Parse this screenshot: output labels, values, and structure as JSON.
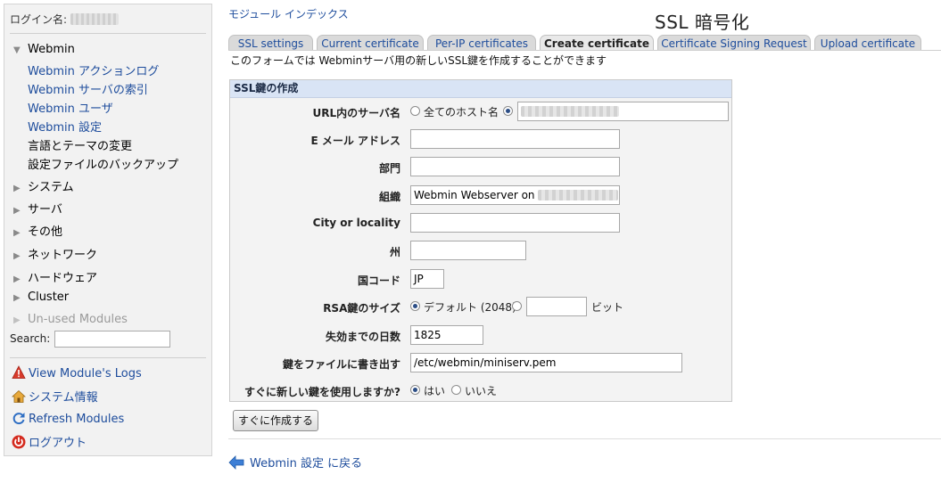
{
  "sidebar": {
    "login_label": "ログイン名:",
    "webmin_category": "Webmin",
    "webmin_items": [
      "Webmin アクションログ",
      "Webmin サーバの索引",
      "Webmin ユーザ",
      "Webmin 設定",
      "言語とテーマの変更",
      "設定ファイルのバックアップ"
    ],
    "categories": [
      "システム",
      "サーバ",
      "その他",
      "ネットワーク",
      "ハードウェア",
      "Cluster",
      "Un-used Modules"
    ],
    "search_label": "Search:",
    "search_value": "",
    "tools": [
      {
        "label": "View Module's Logs",
        "icon": "warning-icon"
      },
      {
        "label": "システム情報",
        "icon": "home-icon"
      },
      {
        "label": "Refresh Modules",
        "icon": "refresh-icon"
      },
      {
        "label": "ログアウト",
        "icon": "power-icon"
      }
    ]
  },
  "header": {
    "module_index": "モジュール インデックス",
    "title": "SSL 暗号化"
  },
  "tabs": [
    {
      "label": "SSL settings",
      "active": false
    },
    {
      "label": "Current certificate",
      "active": false
    },
    {
      "label": "Per-IP certificates",
      "active": false
    },
    {
      "label": "Create certificate",
      "active": true
    },
    {
      "label": "Certificate Signing Request",
      "active": false
    },
    {
      "label": "Upload certificate",
      "active": false
    }
  ],
  "description": "このフォームでは Webminサーバ用の新しいSSL鍵を作成することができます",
  "form": {
    "header": "SSL鍵の作成",
    "hostname_label": "URL内のサーバ名",
    "hostname_option_all": "全てのホスト名",
    "email_label": "E メール アドレス",
    "email_value": "",
    "department_label": "部門",
    "department_value": "",
    "organization_label": "組織",
    "organization_value": "Webmin Webserver on",
    "city_label": "City or locality",
    "city_value": "",
    "state_label": "州",
    "state_value": "",
    "country_label": "国コード",
    "country_value": "JP",
    "rsa_label": "RSA鍵のサイズ",
    "rsa_default_option": "デフォルト (2048)",
    "rsa_custom_value": "",
    "rsa_unit": "ビット",
    "days_label": "失効までの日数",
    "days_value": "1825",
    "file_label": "鍵をファイルに書き出す",
    "file_value": "/etc/webmin/miniserv.pem",
    "use_now_label": "すぐに新しい鍵を使用しますか?",
    "yes_option": "はい",
    "no_option": "いいえ",
    "submit_label": "すぐに作成する"
  },
  "footer": {
    "return_link": "Webmin 設定 に戻る"
  },
  "colors": {
    "link": "#1d4c9c",
    "form_header_bg": "#d9e4f5",
    "tab_bg": "#dadada",
    "sidebar_bg": "#f2f2f2"
  }
}
